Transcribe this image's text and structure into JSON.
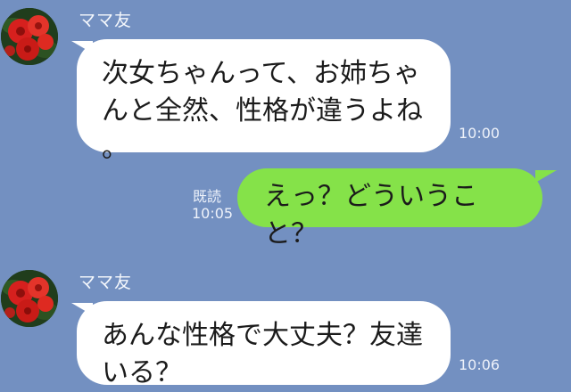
{
  "messages": [
    {
      "direction": "incoming",
      "sender": "ママ友",
      "avatar_icon": "red-flower-avatar-icon",
      "lines": [
        "次女ちゃんって、お姉ちゃ",
        "んと全然、性格が違うよね",
        "。"
      ],
      "time": "10:00"
    },
    {
      "direction": "outgoing",
      "read_status": "既読",
      "text": "えっ？どういうこと？",
      "time": "10:05"
    },
    {
      "direction": "incoming",
      "sender": "ママ友",
      "avatar_icon": "red-flower-avatar-icon",
      "lines": [
        "あんな性格で大丈夫？友達",
        "いる？"
      ],
      "time": "10:06"
    }
  ],
  "colors": {
    "background": "#7390c1",
    "incoming_bubble": "#ffffff",
    "outgoing_bubble": "#85e249",
    "meta_text": "#eef2fa"
  }
}
